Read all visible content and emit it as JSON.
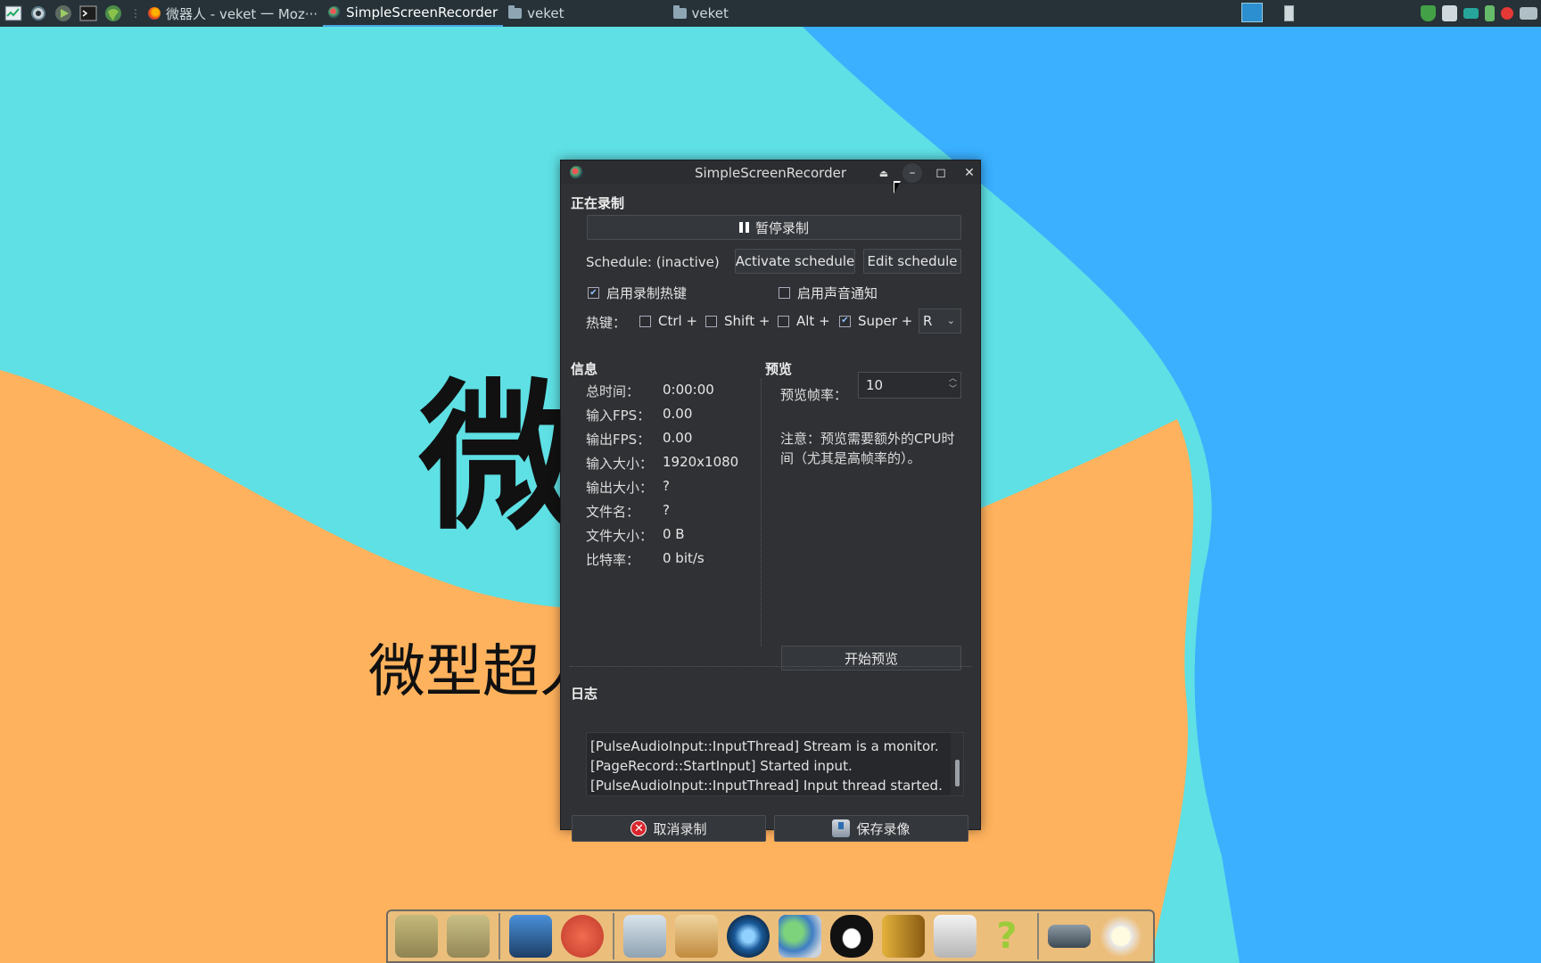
{
  "desktop": {
    "big_char": "微",
    "sub_text": "微型超人",
    "colors": {
      "cyan": "#5ee0e4",
      "orange": "#ffb25d",
      "blue": "#3ab0ff"
    }
  },
  "taskbar": {
    "launchers": [
      "system-monitor-icon",
      "settings-icon",
      "run-icon",
      "terminal-icon",
      "browser-icon"
    ],
    "tasks": [
      {
        "label": "微器人 - veket 一 Moz···",
        "icon": "firefox-icon",
        "active": false
      },
      {
        "label": "SimpleScreenRecorder",
        "icon": "ssr-icon",
        "active": true
      },
      {
        "label": "veket",
        "icon": "folder-icon",
        "active": false
      },
      {
        "label": "veket",
        "icon": "folder-icon",
        "active": false
      }
    ],
    "tray": [
      "shield-icon",
      "clipboard-icon",
      "network-icon",
      "battery-icon",
      "record-icon",
      "keyboard-icon"
    ]
  },
  "window": {
    "title": "SimpleScreenRecorder",
    "recording": {
      "section_title": "正在录制",
      "pause_label": "暂停录制",
      "schedule_status": "Schedule: (inactive)",
      "activate_schedule": "Activate schedule",
      "edit_schedule": "Edit schedule",
      "enable_hotkey": "启用录制热键",
      "enable_hotkey_checked": true,
      "enable_sound": "启用声音通知",
      "enable_sound_checked": false,
      "hotkey_label": "热键：",
      "modifiers": [
        {
          "label": "Ctrl +",
          "checked": false
        },
        {
          "label": "Shift +",
          "checked": false
        },
        {
          "label": "Alt +",
          "checked": false
        },
        {
          "label": "Super +",
          "checked": true
        }
      ],
      "key": "R"
    },
    "info": {
      "section_title": "信息",
      "rows": [
        {
          "key": "总时间：",
          "value": "0:00:00"
        },
        {
          "key": "输入FPS：",
          "value": "0.00"
        },
        {
          "key": "输出FPS：",
          "value": "0.00"
        },
        {
          "key": "输入大小：",
          "value": "1920x1080"
        },
        {
          "key": "输出大小：",
          "value": "?"
        },
        {
          "key": "文件名：",
          "value": "?"
        },
        {
          "key": "文件大小：",
          "value": "0 B"
        },
        {
          "key": "比特率：",
          "value": "0 bit/s"
        }
      ]
    },
    "preview": {
      "section_title": "预览",
      "rate_label": "预览帧率：",
      "rate_value": "10",
      "note": "注意：预览需要额外的CPU时间（尤其是高帧率的）。",
      "start_preview": "开始预览"
    },
    "log": {
      "section_title": "日志",
      "lines": [
        "[PulseAudioInput::InputThread] Stream is a monitor.",
        "[PageRecord::StartInput] Started input.",
        "[PulseAudioInput::InputThread] Input thread started."
      ]
    },
    "cancel_label": "取消录制",
    "save_label": "保存录像"
  },
  "dock": {
    "items": [
      "home-folder-icon",
      "files-folder-icon",
      "display-settings-icon",
      "mascot-icon",
      "text-editor-icon",
      "paint-icon",
      "media-player-icon",
      "network-users-icon",
      "qq-penguin-icon",
      "door-icon",
      "chart-app-icon",
      "help-icon",
      "scanner-icon",
      "brightness-icon"
    ]
  }
}
